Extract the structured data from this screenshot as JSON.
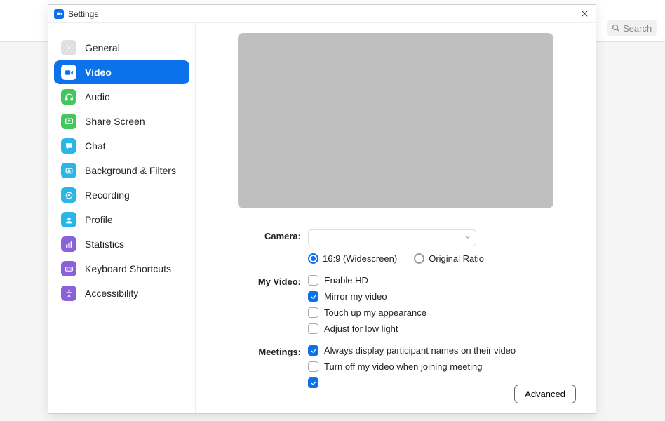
{
  "window": {
    "title": "Settings"
  },
  "search": {
    "placeholder": "Search"
  },
  "sidebar": {
    "items": [
      {
        "label": "General"
      },
      {
        "label": "Video"
      },
      {
        "label": "Audio"
      },
      {
        "label": "Share Screen"
      },
      {
        "label": "Chat"
      },
      {
        "label": "Background & Filters"
      },
      {
        "label": "Recording"
      },
      {
        "label": "Profile"
      },
      {
        "label": "Statistics"
      },
      {
        "label": "Keyboard Shortcuts"
      },
      {
        "label": "Accessibility"
      }
    ]
  },
  "labels": {
    "camera": "Camera:",
    "myVideo": "My Video:",
    "meetings": "Meetings:"
  },
  "radios": {
    "widescreen": "16:9 (Widescreen)",
    "original": "Original Ratio"
  },
  "checks": {
    "enableHd": "Enable HD",
    "mirror": "Mirror my video",
    "touchup": "Touch up my appearance",
    "lowlight": "Adjust for low light",
    "displayNames": "Always display participant names on their video",
    "turnOff": "Turn off my video when joining meeting"
  },
  "buttons": {
    "advanced": "Advanced"
  }
}
